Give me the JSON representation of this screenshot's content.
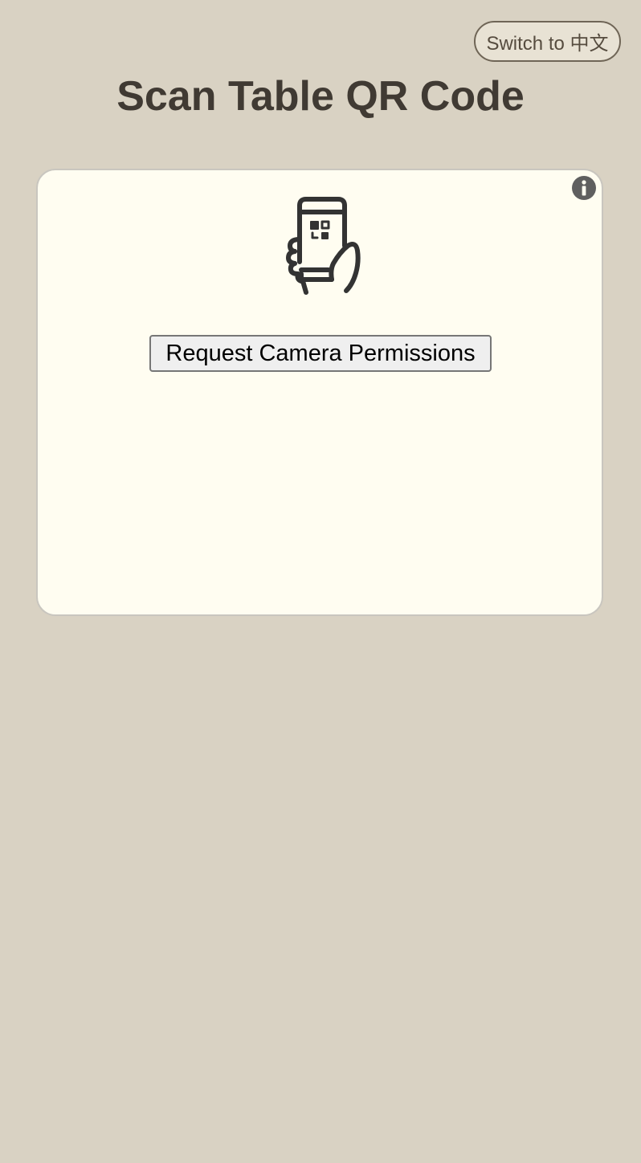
{
  "header": {
    "language_toggle_label": "Switch to 中文",
    "title": "Scan Table QR Code"
  },
  "scanner": {
    "request_button_label": "Request Camera Permissions",
    "illustration_icon": "phone-qr-scan-icon",
    "info_icon": "info-icon"
  },
  "colors": {
    "page_background": "#d9d2c3",
    "card_background": "#fffdf1",
    "title_text": "#403a33",
    "icon_dark": "#333333"
  }
}
